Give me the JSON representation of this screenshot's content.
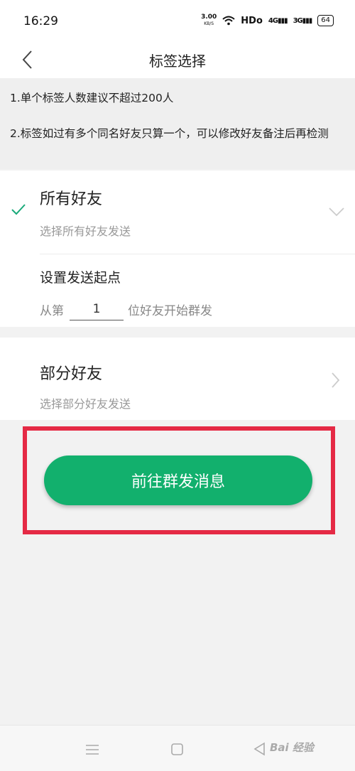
{
  "status": {
    "time": "16:29",
    "speed": "3.00",
    "speed_unit": "KB/S",
    "hd": "HDo",
    "sig1": "4G",
    "sig2": "3G",
    "battery": "64"
  },
  "nav": {
    "title": "标签选择"
  },
  "notes": [
    "1.单个标签人数建议不超过200人",
    "2.标签如过有多个同名好友只算一个，可以修改好友备注后再检测"
  ],
  "all_friends": {
    "title": "所有好友",
    "subtitle": "选择所有好友发送",
    "selected": true
  },
  "start": {
    "title": "设置发送起点",
    "prefix": "从第",
    "value": "1",
    "suffix": "位好友开始群发"
  },
  "part_friends": {
    "title": "部分好友",
    "subtitle": "选择部分好友发送"
  },
  "action": {
    "button": "前往群发消息"
  },
  "colors": {
    "accent": "#12b06d",
    "highlight": "#e52a45",
    "check": "#1aaa7a"
  },
  "watermark": "Bai 经验"
}
